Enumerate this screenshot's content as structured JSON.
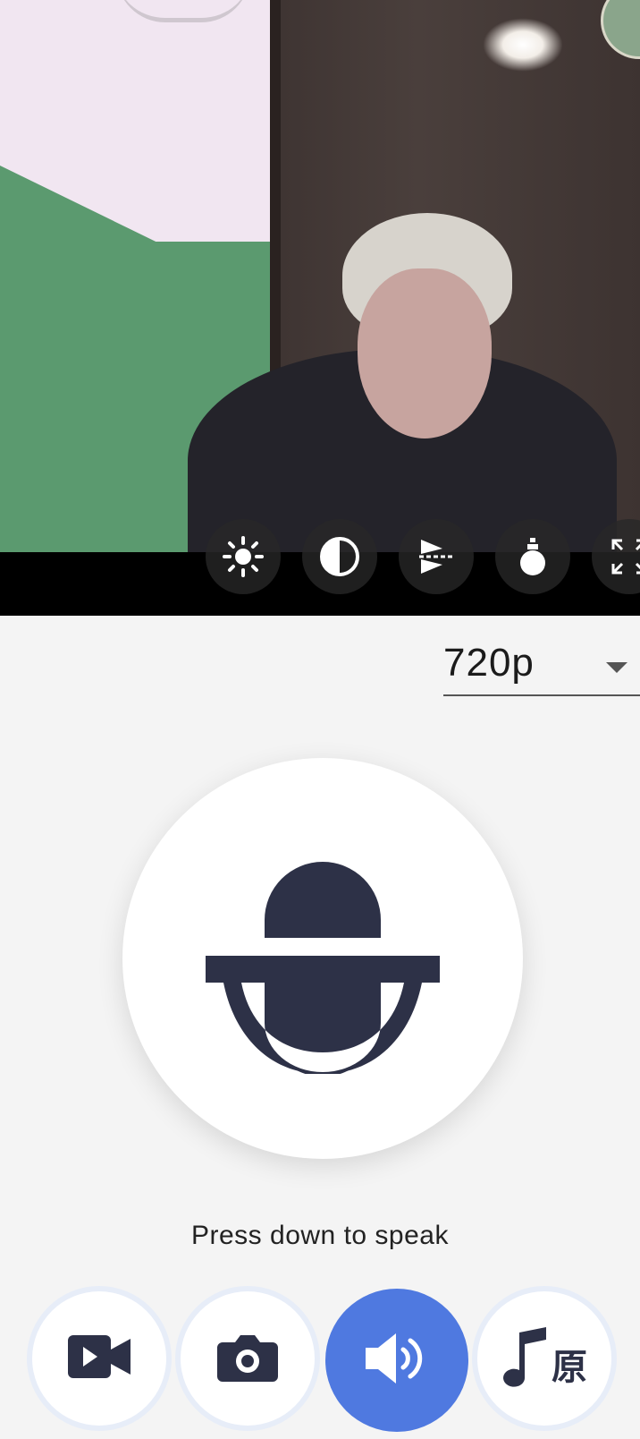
{
  "camera": {
    "controls": [
      {
        "name": "brightness-control",
        "icon": "sun-icon"
      },
      {
        "name": "contrast-control",
        "icon": "contrast-icon"
      },
      {
        "name": "flip-control",
        "icon": "flip-icon"
      },
      {
        "name": "night-control",
        "icon": "bulb-icon"
      },
      {
        "name": "fullscreen-control",
        "icon": "expand-icon"
      }
    ]
  },
  "resolution": {
    "selected": "720p"
  },
  "voice": {
    "hint": "Press down to speak"
  },
  "bottom_bar": {
    "music_label": "原"
  },
  "colors": {
    "accent": "#4f79e0",
    "icon": "#2d3147",
    "background": "#f4f4f4"
  }
}
